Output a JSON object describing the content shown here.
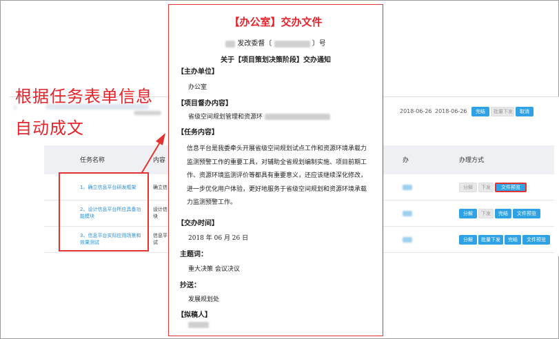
{
  "annotation": {
    "line1": "根据任务表单信息",
    "line2": "自动成文"
  },
  "header": {
    "date_start": "2018-06-26",
    "date_end": "2018-06-26",
    "buttons": {
      "complete": "完结",
      "batch_issue": "批量下发",
      "cancel": "取消"
    }
  },
  "table": {
    "columns": {
      "task_name": "任务名称",
      "content": "内容",
      "handle": "办理方式"
    },
    "partial_column": "办",
    "rows": [
      {
        "name": "1、确立信息平台研发框架",
        "content": "确立信",
        "buttons": {
          "split": "分解",
          "issue": "下发",
          "preview": "文件预览"
        }
      },
      {
        "name": "2、设计信息平台所应具备功能模块",
        "content": "设计信块",
        "buttons": {
          "split": "分解",
          "issue": "下发",
          "complete": "完结",
          "preview": "文件预览"
        }
      },
      {
        "name": "3、信息平台实际应用场景和效果测试",
        "content": "信息平试",
        "buttons": {
          "split": "分解",
          "batch_issue": "批量下发",
          "complete": "完结",
          "preview": "文件预览"
        }
      }
    ]
  },
  "document": {
    "title": "【办公室】交办文件",
    "number_mid": "发改委督〔",
    "number_end": "〕号",
    "subject": "关于【项目策划决策阶段】交办通知",
    "sections": {
      "host_label": "【主办单位】",
      "host_value": "办公室",
      "supervise_label": "【项目督办内容】",
      "supervise_value": "省级空间规划管理和资源环",
      "task_label": "【任务内容】",
      "task_text": "信息平台是我委牵头开展省级空间规划试点工作和资源环境承载力监测预警工作的重要工具，对辅助全省规划编制实施、项目前期工作、资源环境监测评价等都具有重要意义，还应该继续深化修改，进一步优化用户体验，更好地服务于省级空间规划和资源环境承载力监测预警工作。",
      "time_label": "【交办时间】",
      "time_value": "2018 年 06 月 26 日",
      "keywords_label": "主题词：",
      "keywords_value": "重大决策  会议决议",
      "cc_label": "抄送：",
      "cc_value": "发展规划处",
      "drafter_label": "【拟稿人】"
    }
  },
  "colors": {
    "accent_red": "#e5232a",
    "button_blue": "#2ea2e5",
    "link_blue": "#2a8fd6"
  }
}
